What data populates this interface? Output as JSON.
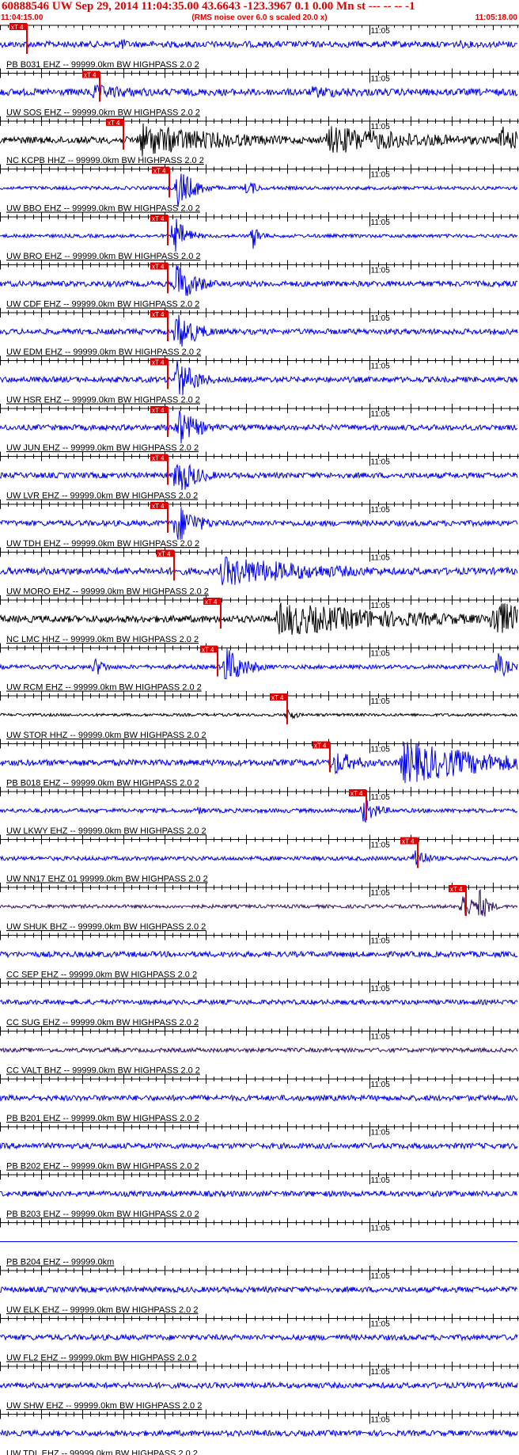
{
  "header": {
    "title": "60888546 UW Sep 29, 2014 11:04:35.00   43.6643 -123.3967  0.1 0.00 Mn st --- -- --  -1",
    "start_time": "11:04:15.00",
    "rms_note": "(RMS noise over 6.0 s scaled 20.0 x)",
    "end_time": "11:05:18.00"
  },
  "colors": {
    "header": "#e00000",
    "pick": "#e00000",
    "tick_color": "#000000"
  },
  "chart_data": {
    "type": "line",
    "title": "60888546 UW Sep 29, 2014 11:04:35.00   43.6643 -123.3967  0.1 0.00 Mn st --- -- --  -1",
    "x_start": "11:04:15.00",
    "x_end": "11:05:18.00",
    "x_mark_label": "11:05",
    "x_mark_seconds": 45,
    "duration_seconds": 63,
    "pick_label": "xT 4",
    "series": [
      {
        "label": "PB B031 EHZ -- 99999.0km BW  HIGHPASS  2.0  2",
        "color": "#0000ee",
        "pick_s": 3.3,
        "amp": 0.18,
        "events": [
          [
            14.5,
            0.5,
            1.2
          ],
          [
            56,
            0.25,
            4
          ]
        ]
      },
      {
        "label": "UW SOS EHZ -- 99999.0km BW  HIGHPASS  2.0  2",
        "color": "#0000ee",
        "pick_s": 12.1,
        "amp": 0.2,
        "events": [
          [
            11,
            0.45,
            10
          ],
          [
            38,
            0.35,
            14
          ]
        ]
      },
      {
        "label": "NC KCPB HHZ -- 99999.0km BW  HIGHPASS  2.0  2",
        "color": "#000000",
        "pick_s": 15.0,
        "amp": 0.2,
        "events": [
          [
            17,
            1.0,
            12
          ],
          [
            40,
            0.85,
            14
          ],
          [
            61,
            0.9,
            3
          ]
        ]
      },
      {
        "label": "UW BBO EHZ -- 99999.0km BW  HIGHPASS  2.0  2",
        "color": "#0000ee",
        "pick_s": 20.6,
        "amp": 0.1,
        "events": [
          [
            21.5,
            1.3,
            2.2
          ],
          [
            30.1,
            0.6,
            1.2
          ]
        ]
      },
      {
        "label": "UW BRO EHZ -- 99999.0km BW  HIGHPASS  2.0  2",
        "color": "#0000ee",
        "pick_s": 20.4,
        "amp": 0.1,
        "events": [
          [
            21.2,
            1.2,
            1.6
          ],
          [
            30.8,
            0.8,
            1.0
          ]
        ]
      },
      {
        "label": "UW CDF EHZ -- 99999.0km BW  HIGHPASS  2.0  2",
        "color": "#0000ee",
        "pick_s": 20.4,
        "amp": 0.16,
        "events": [
          [
            21.4,
            1.3,
            2.6
          ]
        ]
      },
      {
        "label": "UW EDM EHZ -- 99999.0km BW  HIGHPASS  2.0  2",
        "color": "#0000ee",
        "pick_s": 20.4,
        "amp": 0.16,
        "events": [
          [
            21.4,
            1.3,
            2.6
          ]
        ]
      },
      {
        "label": "UW HSR EHZ -- 99999.0km BW  HIGHPASS  2.0  2",
        "color": "#0000ee",
        "pick_s": 20.4,
        "amp": 0.16,
        "events": [
          [
            21.4,
            1.3,
            2.6
          ]
        ]
      },
      {
        "label": "UW JUN EHZ -- 99999.0km BW  HIGHPASS  2.0  2",
        "color": "#0000ee",
        "pick_s": 20.4,
        "amp": 0.16,
        "events": [
          [
            21.4,
            1.3,
            2.6
          ]
        ]
      },
      {
        "label": "UW LVR EHZ -- 99999.0km BW  HIGHPASS  2.0  2",
        "color": "#0000ee",
        "pick_s": 20.4,
        "amp": 0.16,
        "events": [
          [
            21.4,
            1.3,
            2.6
          ]
        ]
      },
      {
        "label": "UW TDH EHZ -- 99999.0km BW  HIGHPASS  2.0  2",
        "color": "#0000ee",
        "pick_s": 20.4,
        "amp": 0.16,
        "events": [
          [
            21.4,
            1.3,
            2.6
          ]
        ]
      },
      {
        "label": "UW MORO EHZ -- 99999.0km BW  HIGHPASS  2.0  2",
        "color": "#0000ee",
        "pick_s": 21.2,
        "amp": 0.2,
        "events": [
          [
            27,
            0.9,
            14
          ]
        ]
      },
      {
        "label": "NC LMC HHZ -- 99999.0km BW  HIGHPASS  2.0  2",
        "color": "#000000",
        "pick_s": 26.9,
        "amp": 0.2,
        "events": [
          [
            34,
            1.0,
            18
          ],
          [
            60,
            1.2,
            6
          ]
        ]
      },
      {
        "label": "UW RCM EHZ -- 99999.0km BW  HIGHPASS  2.0  2",
        "color": "#0000ee",
        "pick_s": 26.5,
        "amp": 0.12,
        "events": [
          [
            11.5,
            0.6,
            1.5
          ],
          [
            27.3,
            1.3,
            2.5
          ],
          [
            60.5,
            0.9,
            1.5
          ]
        ]
      },
      {
        "label": "UW STOR HHZ -- 99999.0km BW  HIGHPASS  2.0  2",
        "color": "#000000",
        "pick_s": 35.0,
        "amp": 0.08,
        "events": [
          [
            35,
            0.5,
            1
          ]
        ]
      },
      {
        "label": "PB B018 EHZ -- 99999.0km BW  HIGHPASS  2.0  2",
        "color": "#0000ee",
        "pick_s": 40.2,
        "amp": 0.18,
        "events": [
          [
            40.5,
            0.8,
            3.5
          ],
          [
            49,
            1.3,
            12
          ]
        ]
      },
      {
        "label": "UW LKWY EHZ -- 99999.0km BW  HIGHPASS  2.0  2",
        "color": "#0000ee",
        "pick_s": 44.6,
        "amp": 0.12,
        "events": [
          [
            44.2,
            0.8,
            2
          ],
          [
            24,
            0.25,
            2
          ]
        ]
      },
      {
        "label": "UW NN17 EHZ 01 99999.0km BW  HIGHPASS  2.0  2",
        "color": "#0000ee",
        "pick_s": 50.9,
        "amp": 0.12,
        "events": [
          [
            50.5,
            0.8,
            1.5
          ]
        ]
      },
      {
        "label": "UW SHUK BHZ -- 99999.0km BW  HIGHPASS  2.0  2",
        "color": "#331166",
        "pick_s": 56.7,
        "amp": 0.1,
        "events": [
          [
            56.2,
            1.2,
            1.2
          ],
          [
            58.2,
            1.2,
            1.2
          ]
        ]
      },
      {
        "label": "CC SEP EHZ -- 99999.0km BW  HIGHPASS  2.0  2",
        "color": "#0000ee",
        "pick_s": null,
        "amp": 0.16,
        "events": []
      },
      {
        "label": "CC SUG EHZ -- 99999.0km BW  HIGHPASS  2.0  2",
        "color": "#0000ee",
        "pick_s": null,
        "amp": 0.14,
        "events": []
      },
      {
        "label": "CC VALT BHZ -- 99999.0km BW  HIGHPASS  2.0  2",
        "color": "#331166",
        "pick_s": null,
        "amp": 0.12,
        "events": []
      },
      {
        "label": "PB B201 EHZ -- 99999.0km BW  HIGHPASS  2.0  2",
        "color": "#0000ee",
        "pick_s": null,
        "amp": 0.16,
        "events": []
      },
      {
        "label": "PB B202 EHZ -- 99999.0km BW  HIGHPASS  2.0  2",
        "color": "#0000ee",
        "pick_s": null,
        "amp": 0.16,
        "events": []
      },
      {
        "label": "PB B203 EHZ -- 99999.0km BW  HIGHPASS  2.0  2",
        "color": "#0000ee",
        "pick_s": null,
        "amp": 0.16,
        "events": []
      },
      {
        "label": "PB B204 EHZ -- 99999.0km",
        "color": "#0000ee",
        "pick_s": null,
        "amp": 0,
        "events": []
      },
      {
        "label": "UW ELK EHZ -- 99999.0km BW  HIGHPASS  2.0  2",
        "color": "#0000ee",
        "pick_s": null,
        "amp": 0.16,
        "events": []
      },
      {
        "label": "UW FL2 EHZ -- 99999.0km BW  HIGHPASS  2.0  2",
        "color": "#0000ee",
        "pick_s": null,
        "amp": 0.16,
        "events": []
      },
      {
        "label": "UW SHW EHZ -- 99999.0km BW  HIGHPASS  2.0  2",
        "color": "#0000ee",
        "pick_s": null,
        "amp": 0.16,
        "events": []
      },
      {
        "label": "UW TDL EHZ -- 99999.0km BW  HIGHPASS  2.0  2",
        "color": "#0000ee",
        "pick_s": null,
        "amp": 0.16,
        "events": []
      }
    ]
  }
}
